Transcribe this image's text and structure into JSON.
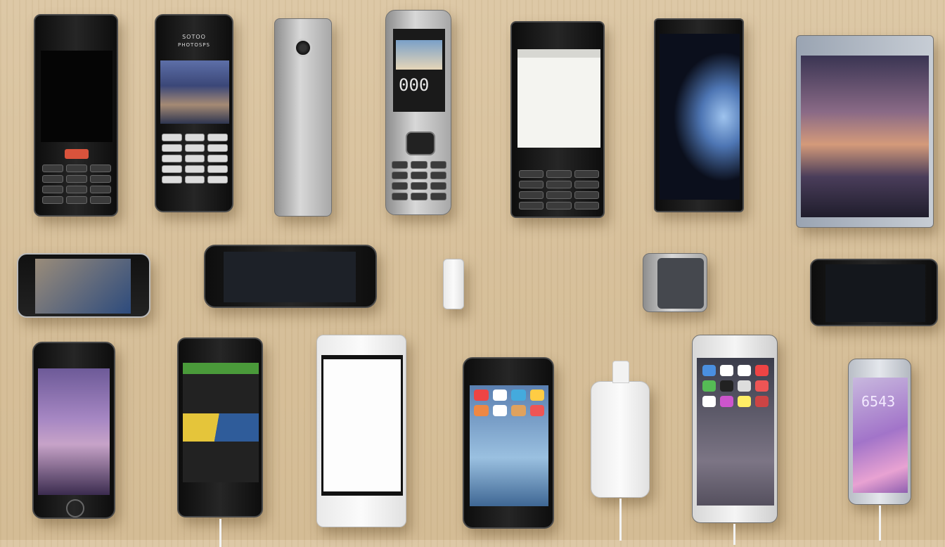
{
  "devices": {
    "phone_2_brand": "SOTOO",
    "phone_2_subbrand": "PHOTOSPS",
    "phone_4_clock": "000",
    "phone_17_lockscreen_text": "6543"
  },
  "colors": {
    "wood_table": "#d6bf99",
    "dark_body": "#1a1a1a",
    "silver_body": "#c8c8c8",
    "white_body": "#f2f2f2"
  }
}
